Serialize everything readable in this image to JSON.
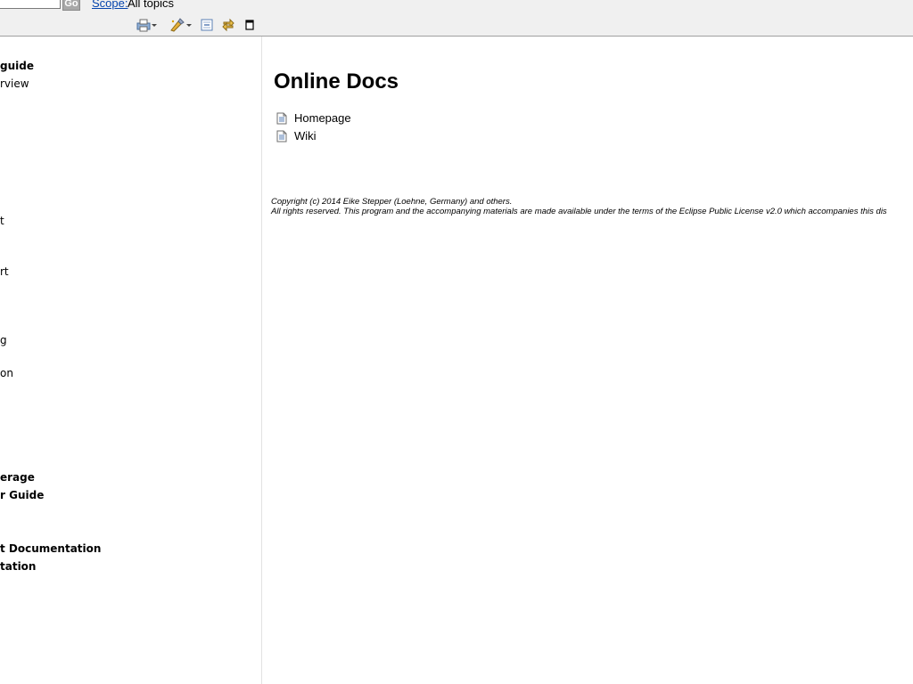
{
  "search": {
    "go_label": "Go",
    "scope_label": "Scope:",
    "scope_value": "All topics"
  },
  "toolbar": {
    "icons": [
      "print-icon",
      "highlight-icon",
      "collapse-all-icon",
      "link-with-contents-icon",
      "maximize-icon"
    ]
  },
  "toc": [
    {
      "label": "guide",
      "bold": true
    },
    {
      "label": "rview",
      "bold": false
    },
    {
      "label": "t",
      "bold": false
    },
    {
      "label": "rt",
      "bold": false
    },
    {
      "label": "g",
      "bold": false
    },
    {
      "label": "on",
      "bold": false
    },
    {
      "label": "erage",
      "bold": true
    },
    {
      "label": "r Guide",
      "bold": true
    },
    {
      "label": "t Documentation",
      "bold": true
    },
    {
      "label": "tation",
      "bold": true
    }
  ],
  "content": {
    "title": "Online Docs",
    "links": [
      {
        "label": "Homepage"
      },
      {
        "label": "Wiki"
      }
    ],
    "copyright_line1": "Copyright (c) 2014 Eike Stepper (Loehne, Germany) and others.",
    "copyright_line2": "All rights reserved. This program and the accompanying materials are made available under the terms of the Eclipse Public License v2.0 which accompanies this dis"
  },
  "colors": {
    "link": "#0645ad",
    "toolbar_bg": "#f0f0f0",
    "go_button": "#a8a8a8"
  }
}
